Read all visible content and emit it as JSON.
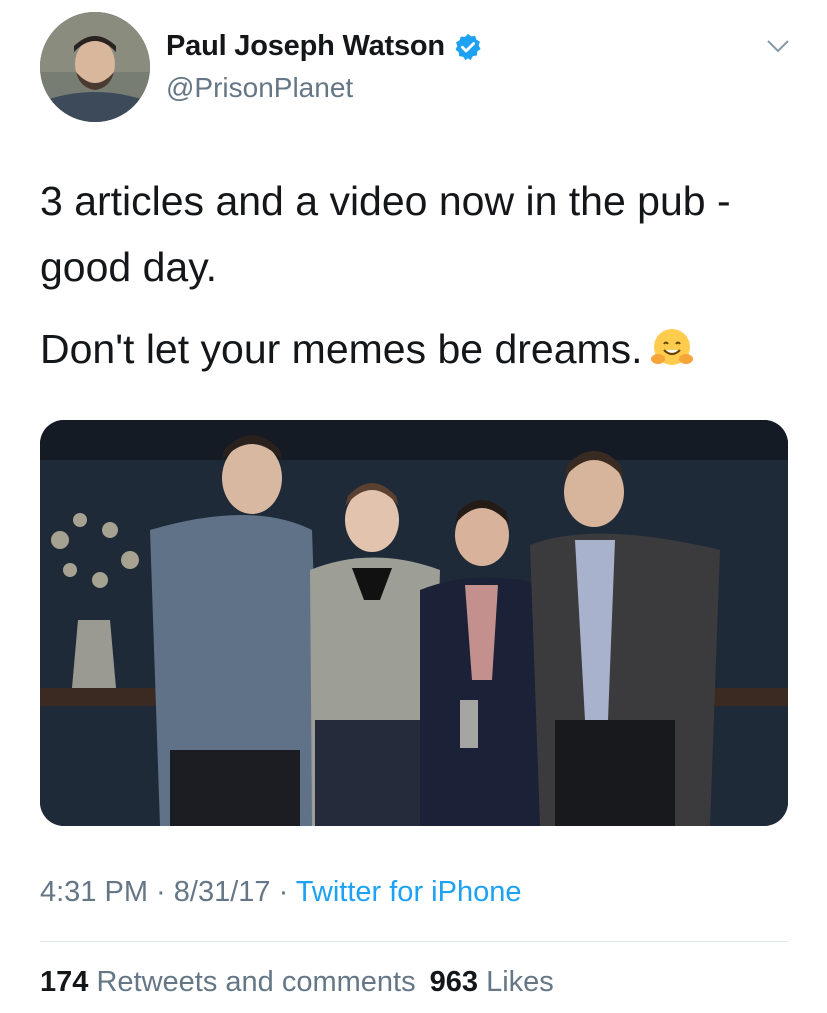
{
  "user": {
    "display_name": "Paul Joseph Watson",
    "handle": "@PrisonPlanet",
    "verified": true,
    "avatar_icon": "profile-photo"
  },
  "tweet": {
    "line1": "3 articles and a video now in the pub - good day.",
    "line2": "Don't let your memes be dreams.",
    "emoji": "hugging-face-emoji",
    "image_alt": "photo"
  },
  "meta": {
    "time": "4:31 PM",
    "date": "8/31/17",
    "source": "Twitter for iPhone",
    "sep": " · "
  },
  "stats": {
    "retweets_count": "174",
    "retweets_label": "Retweets and comments",
    "likes_count": "963",
    "likes_label": "Likes"
  },
  "colors": {
    "text": "#14171a",
    "secondary": "#657786",
    "link": "#1da1f2",
    "divider": "#e1e8ed"
  }
}
